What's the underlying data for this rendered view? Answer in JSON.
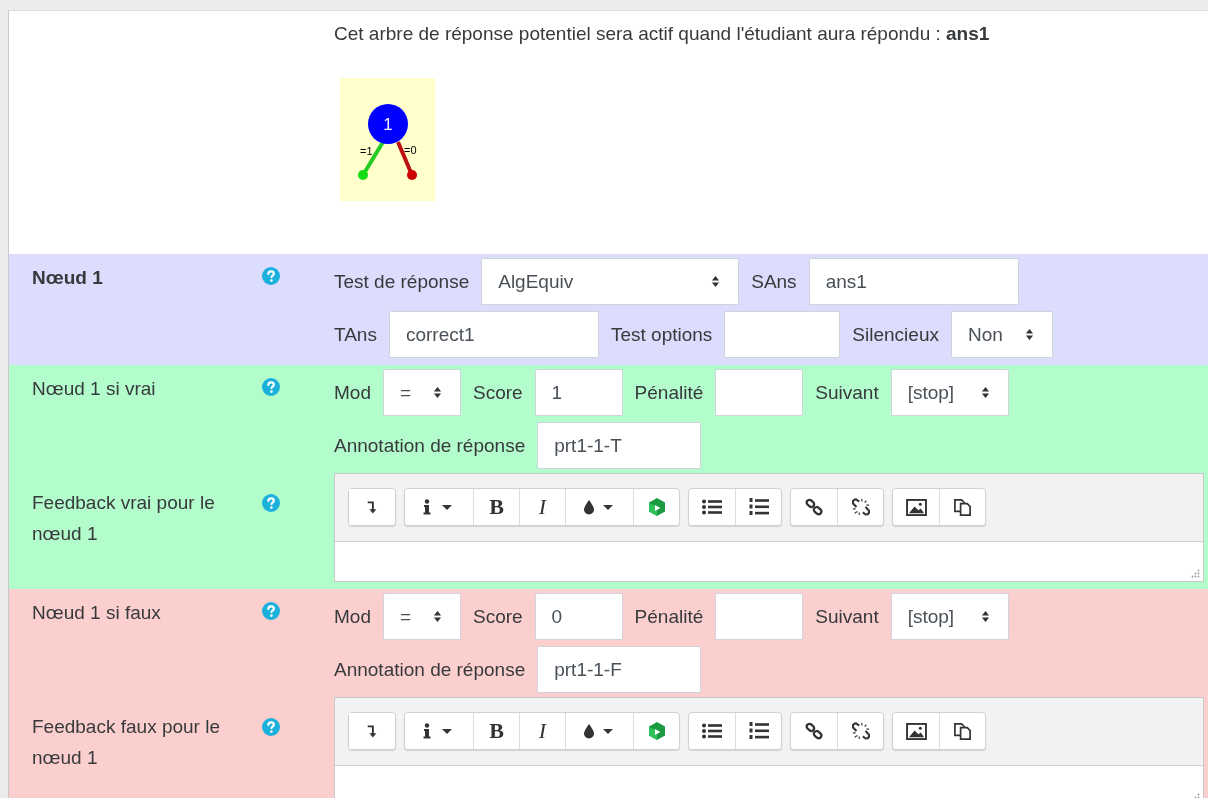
{
  "intro": {
    "text": "Cet arbre de réponse potentiel sera actif quand l'étudiant aura répondu : **ans1**",
    "tree": {
      "node": "1",
      "true_label": "=1",
      "false_label": "=0"
    }
  },
  "sections": [
    {
      "kind": "node",
      "title": "Nœud 1",
      "rows": [
        [
          {
            "label": "Test de réponse",
            "kind": "select",
            "value": "AlgEquiv"
          },
          {
            "label": "SAns",
            "kind": "input",
            "value": "ans1"
          }
        ],
        [
          {
            "label": "TAns",
            "kind": "input",
            "value": "correct1"
          },
          {
            "label": "Test options",
            "kind": "input"
          },
          {
            "label": "Silencieux",
            "kind": "select",
            "value": "Non"
          }
        ]
      ]
    },
    {
      "kind": "true",
      "title": "Nœud 1 si vrai",
      "rows": [
        [
          {
            "label": "Mod",
            "kind": "select",
            "value": "="
          },
          {
            "label": "Score",
            "kind": "input",
            "value": "1"
          },
          {
            "label": "Pénalité",
            "kind": "input"
          },
          {
            "label": "Suivant",
            "kind": "select",
            "value": "[stop]"
          }
        ],
        [
          {
            "label": "Annotation de réponse",
            "kind": "input",
            "value": "prt1-1-T"
          }
        ]
      ],
      "feedback_label": "Feedback vrai pour le nœud 1",
      "toolbar": [
        [
          {
            "kind": "collapse"
          }
        ],
        [
          {
            "kind": "info-menu"
          },
          {
            "kind": "bold",
            "label": "B"
          },
          {
            "kind": "italic",
            "label": "I"
          },
          {
            "kind": "color-menu"
          },
          {
            "kind": "media"
          }
        ],
        [
          {
            "kind": "bullets"
          },
          {
            "kind": "numbers"
          }
        ],
        [
          {
            "kind": "link"
          },
          {
            "kind": "unlink"
          }
        ],
        [
          {
            "kind": "image"
          },
          {
            "kind": "copy"
          }
        ]
      ]
    },
    {
      "kind": "false",
      "title": "Nœud 1 si faux",
      "rows": [
        [
          {
            "label": "Mod",
            "kind": "select",
            "value": "="
          },
          {
            "label": "Score",
            "kind": "input",
            "value": "0"
          },
          {
            "label": "Pénalité",
            "kind": "input"
          },
          {
            "label": "Suivant",
            "kind": "select",
            "value": "[stop]"
          }
        ],
        [
          {
            "label": "Annotation de réponse",
            "kind": "input",
            "value": "prt1-1-F"
          }
        ]
      ],
      "feedback_label": "Feedback faux pour le nœud 1",
      "toolbar": [
        [
          {
            "kind": "collapse"
          }
        ],
        [
          {
            "kind": "info-menu"
          },
          {
            "kind": "bold",
            "label": "B"
          },
          {
            "kind": "italic",
            "label": "I"
          },
          {
            "kind": "color-menu"
          },
          {
            "kind": "media"
          }
        ],
        [
          {
            "kind": "bullets"
          },
          {
            "kind": "numbers"
          }
        ],
        [
          {
            "kind": "link"
          },
          {
            "kind": "unlink"
          }
        ],
        [
          {
            "kind": "image"
          },
          {
            "kind": "copy"
          }
        ]
      ]
    }
  ]
}
